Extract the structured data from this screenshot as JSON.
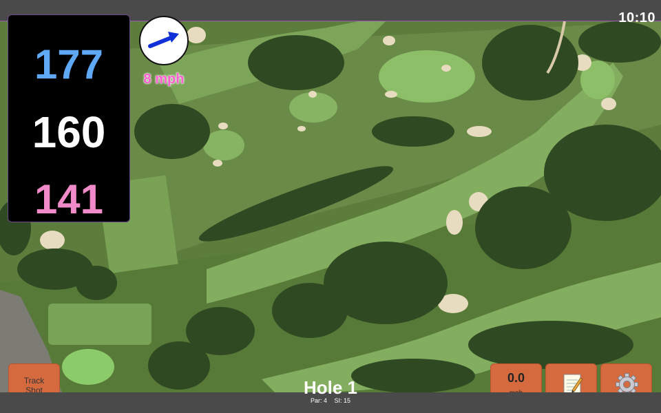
{
  "status": {
    "time": "10:10"
  },
  "yardage": {
    "back": "177",
    "middle": "160",
    "front": "141"
  },
  "wind": {
    "speed_label": "8 mph",
    "direction_icon": "wind-arrow-icon"
  },
  "buttons": {
    "track_shot_line1": "Track",
    "track_shot_line2": "Shot",
    "speed_value": "0.0",
    "speed_unit": "mph",
    "notes_icon": "notepad-icon",
    "settings_icon": "gear-icon"
  },
  "hole": {
    "title": "Hole 1",
    "par": "Par: 4",
    "si": "SI: 15"
  },
  "colors": {
    "back_yardage": "#5fa8f5",
    "middle_yardage": "#ffffff",
    "front_yardage": "#f18ac8",
    "wind_speed": "#ff5fd0",
    "button_bg": "#d56a3f",
    "wind_arrow": "#1030d8"
  }
}
